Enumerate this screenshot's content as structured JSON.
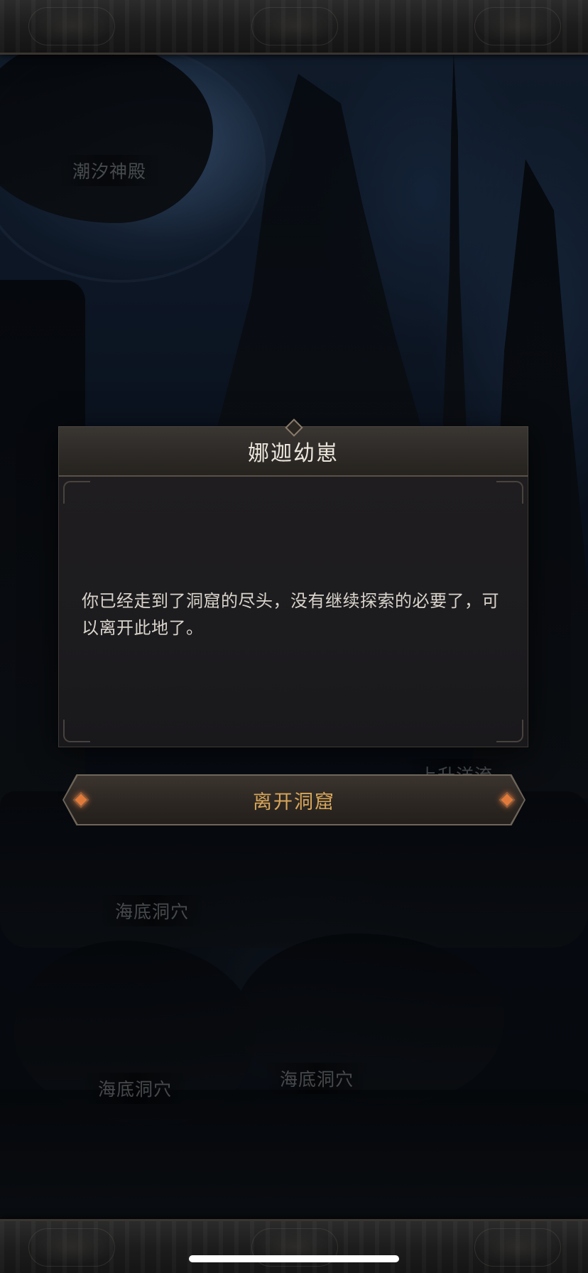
{
  "map": {
    "locations": [
      {
        "label": "潮汐神殿"
      },
      {
        "label": "上升洋流"
      },
      {
        "label": "海底洞穴"
      },
      {
        "label": "海底洞穴"
      },
      {
        "label": "海底洞穴"
      }
    ]
  },
  "dialog": {
    "title": "娜迦幼崽",
    "message": "你已经走到了洞窟的尽头，没有继续探索的必要了，可以离开此地了。"
  },
  "actions": {
    "leave_label": "离开洞窟"
  },
  "colors": {
    "accent_gold": "#d8a65a",
    "gem_orange": "#e07a3a",
    "panel_dark": "#1f1d1f"
  },
  "icons": {
    "header_gem": "diamond-icon",
    "button_gems": "diamond-icon"
  }
}
